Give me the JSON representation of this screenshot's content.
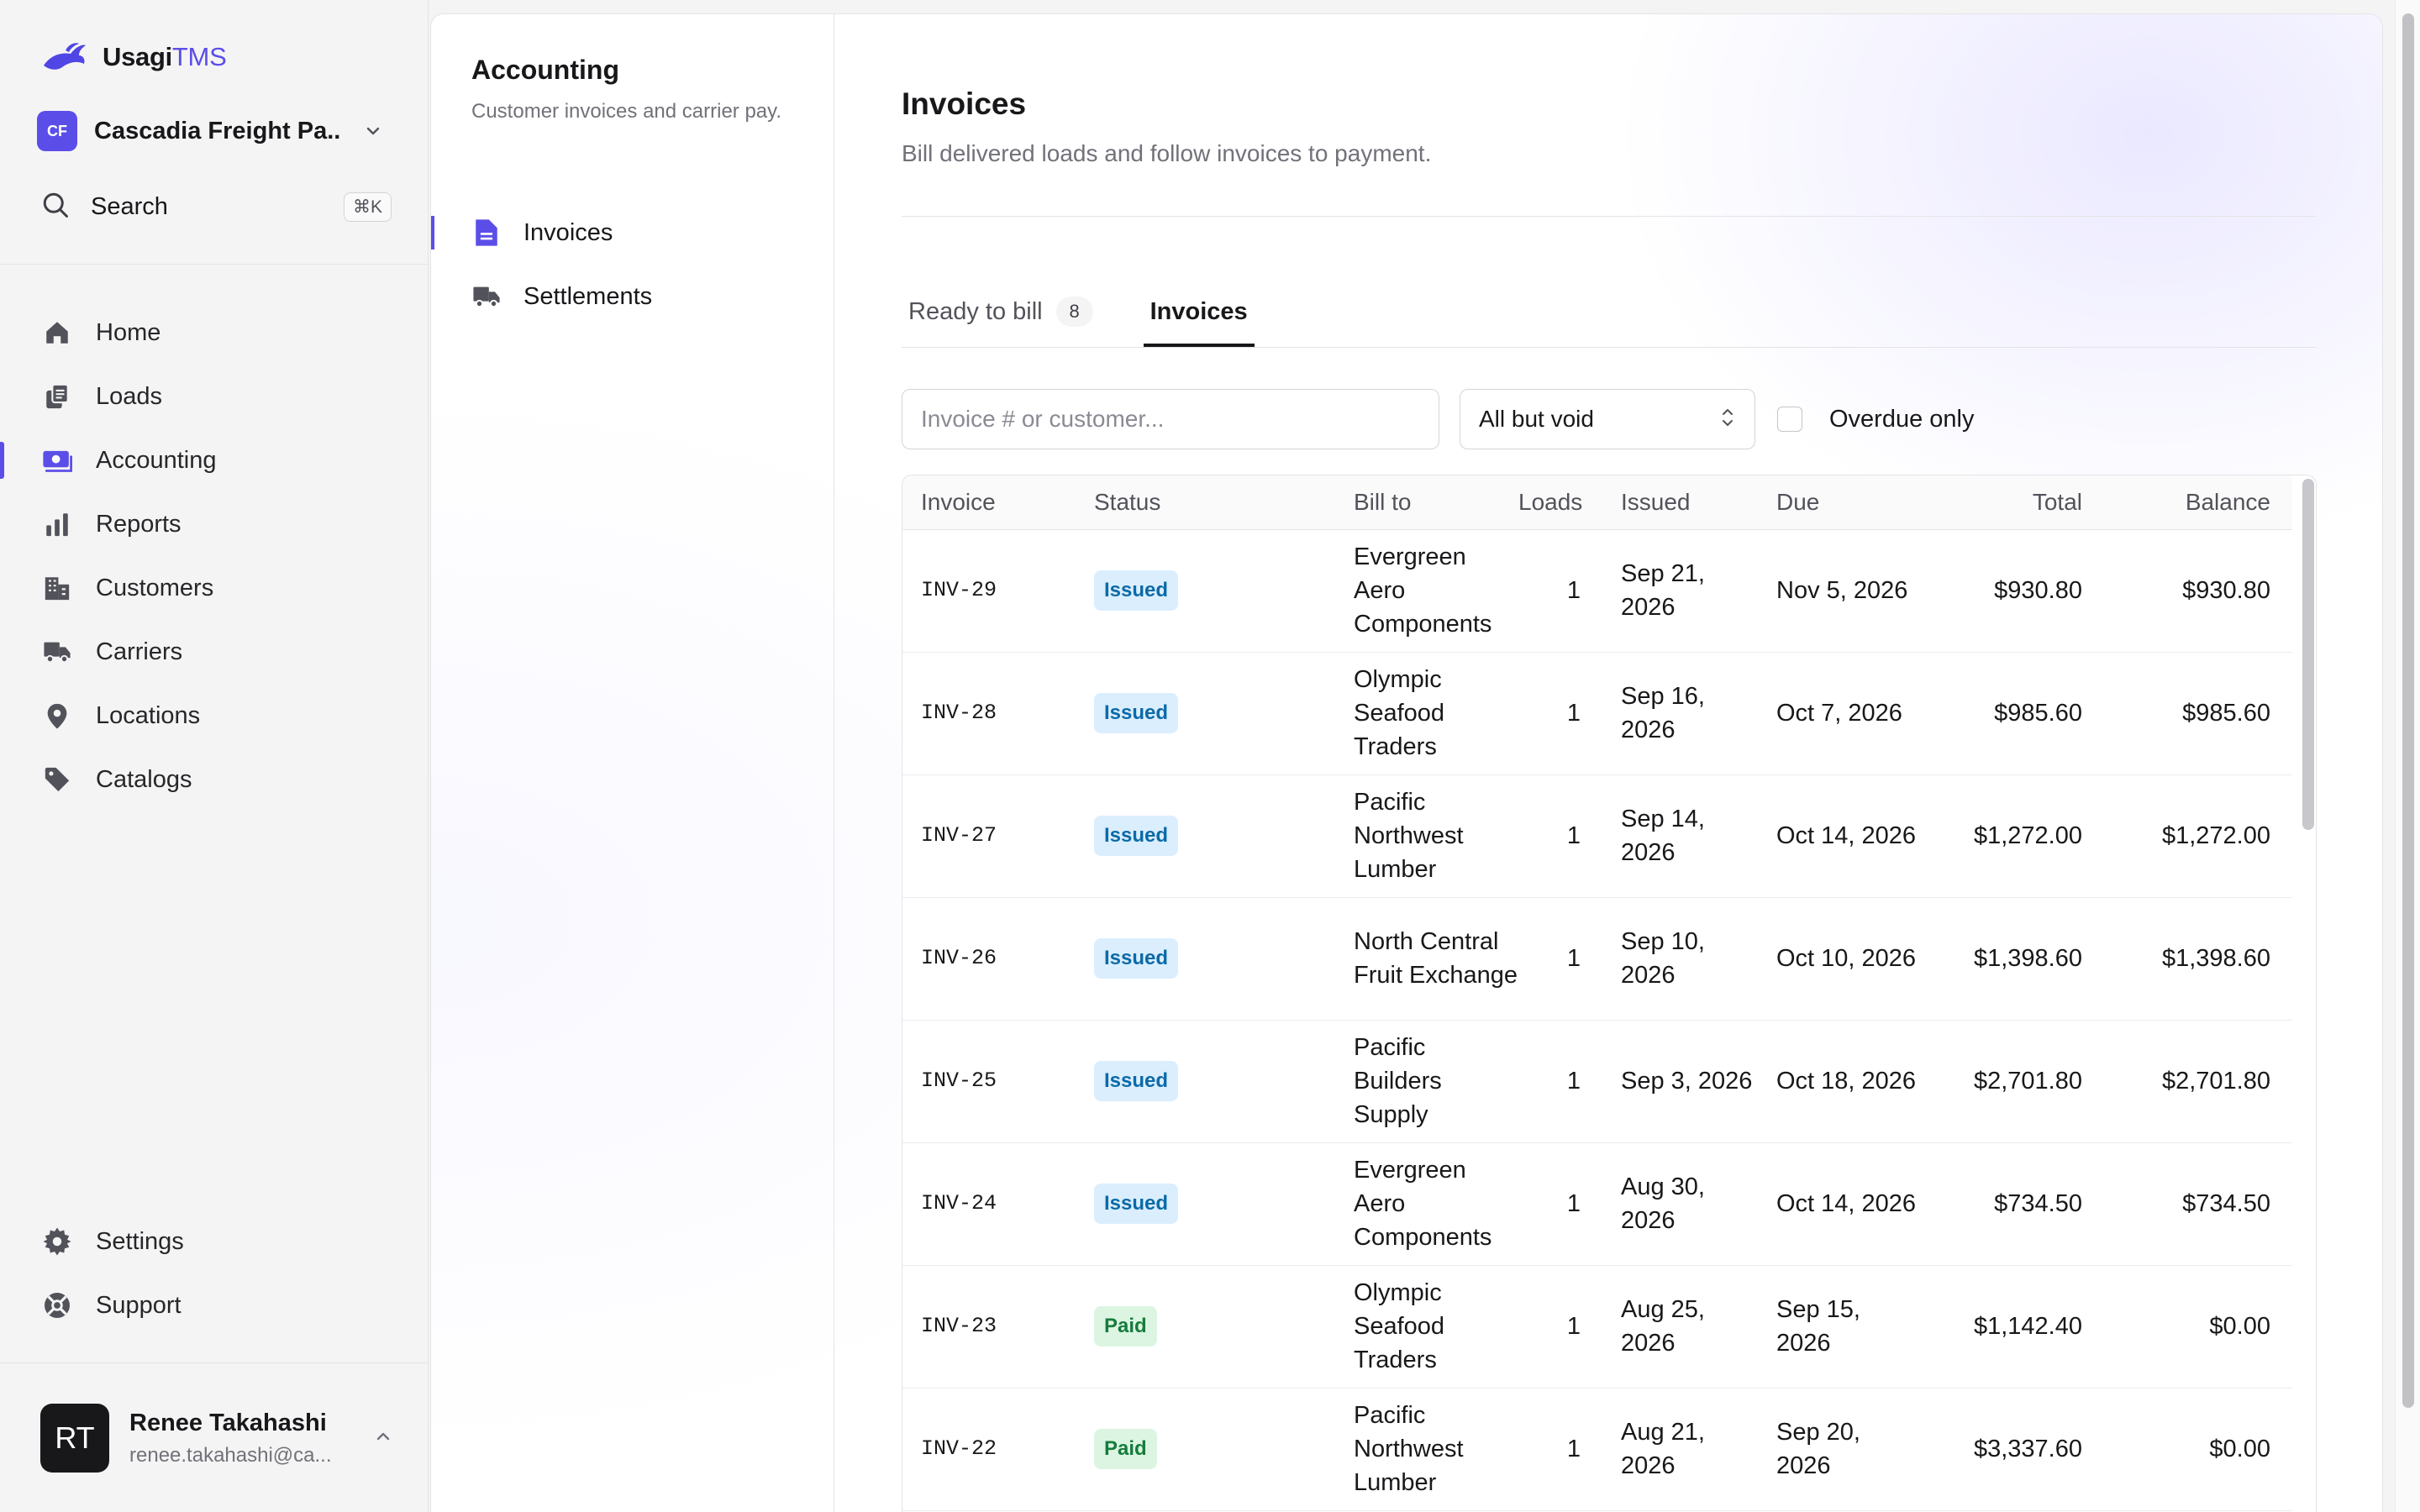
{
  "app": {
    "brand_main": "Usagi",
    "brand_accent": "TMS",
    "workspace_initials": "CF",
    "workspace_name": "Cascadia Freight Pa...",
    "search_label": "Search",
    "search_shortcut": "⌘K"
  },
  "nav": {
    "items": [
      {
        "label": "Home",
        "icon": "home-icon"
      },
      {
        "label": "Loads",
        "icon": "loads-icon"
      },
      {
        "label": "Accounting",
        "icon": "accounting-icon",
        "active": true
      },
      {
        "label": "Reports",
        "icon": "reports-icon"
      },
      {
        "label": "Customers",
        "icon": "customers-icon"
      },
      {
        "label": "Carriers",
        "icon": "truck-icon"
      },
      {
        "label": "Locations",
        "icon": "location-pin-icon"
      },
      {
        "label": "Catalogs",
        "icon": "tag-icon"
      }
    ],
    "bottom": [
      {
        "label": "Settings",
        "icon": "gear-icon"
      },
      {
        "label": "Support",
        "icon": "lifebuoy-icon"
      }
    ]
  },
  "user": {
    "initials": "RT",
    "name": "Renee Takahashi",
    "email": "renee.takahashi@ca..."
  },
  "section": {
    "title": "Accounting",
    "description": "Customer invoices and carrier pay.",
    "items": [
      {
        "label": "Invoices",
        "icon": "document-icon",
        "active": true
      },
      {
        "label": "Settlements",
        "icon": "truck-icon"
      }
    ]
  },
  "page": {
    "title": "Invoices",
    "subtitle": "Bill delivered loads and follow invoices to payment."
  },
  "tabs": [
    {
      "label": "Ready to bill",
      "count": "8"
    },
    {
      "label": "Invoices",
      "active": true
    }
  ],
  "filters": {
    "search_placeholder": "Invoice # or customer...",
    "search_value": "",
    "status_value": "All but void",
    "overdue_label": "Overdue only",
    "overdue_checked": false
  },
  "table": {
    "columns": [
      "Invoice",
      "Status",
      "Bill to",
      "Loads",
      "Issued",
      "Due",
      "Total",
      "Balance"
    ],
    "rows": [
      {
        "invoice": "INV-29",
        "status": "Issued",
        "bill_to": "Evergreen Aero Components",
        "loads": "1",
        "issued": "Sep 21, 2026",
        "due": "Nov 5, 2026",
        "total": "$930.80",
        "balance": "$930.80"
      },
      {
        "invoice": "INV-28",
        "status": "Issued",
        "bill_to": "Olympic Seafood Traders",
        "loads": "1",
        "issued": "Sep 16, 2026",
        "due": "Oct 7, 2026",
        "total": "$985.60",
        "balance": "$985.60"
      },
      {
        "invoice": "INV-27",
        "status": "Issued",
        "bill_to": "Pacific Northwest Lumber",
        "loads": "1",
        "issued": "Sep 14, 2026",
        "due": "Oct 14, 2026",
        "total": "$1,272.00",
        "balance": "$1,272.00"
      },
      {
        "invoice": "INV-26",
        "status": "Issued",
        "bill_to": "North Central Fruit Exchange",
        "loads": "1",
        "issued": "Sep 10, 2026",
        "due": "Oct 10, 2026",
        "total": "$1,398.60",
        "balance": "$1,398.60"
      },
      {
        "invoice": "INV-25",
        "status": "Issued",
        "bill_to": "Pacific Builders Supply",
        "loads": "1",
        "issued": "Sep 3, 2026",
        "due": "Oct 18, 2026",
        "total": "$2,701.80",
        "balance": "$2,701.80"
      },
      {
        "invoice": "INV-24",
        "status": "Issued",
        "bill_to": "Evergreen Aero Components",
        "loads": "1",
        "issued": "Aug 30, 2026",
        "due": "Oct 14, 2026",
        "total": "$734.50",
        "balance": "$734.50"
      },
      {
        "invoice": "INV-23",
        "status": "Paid",
        "bill_to": "Olympic Seafood Traders",
        "loads": "1",
        "issued": "Aug 25, 2026",
        "due": "Sep 15, 2026",
        "total": "$1,142.40",
        "balance": "$0.00"
      },
      {
        "invoice": "INV-22",
        "status": "Paid",
        "bill_to": "Pacific Northwest Lumber",
        "loads": "1",
        "issued": "Aug 21, 2026",
        "due": "Sep 20, 2026",
        "total": "$3,337.60",
        "balance": "$0.00"
      }
    ]
  },
  "colors": {
    "accent": "#5b4ee8",
    "issued_bg": "#dbeefe",
    "issued_text": "#0b6aa8",
    "paid_bg": "#dcf5e3",
    "paid_text": "#167c3b"
  }
}
